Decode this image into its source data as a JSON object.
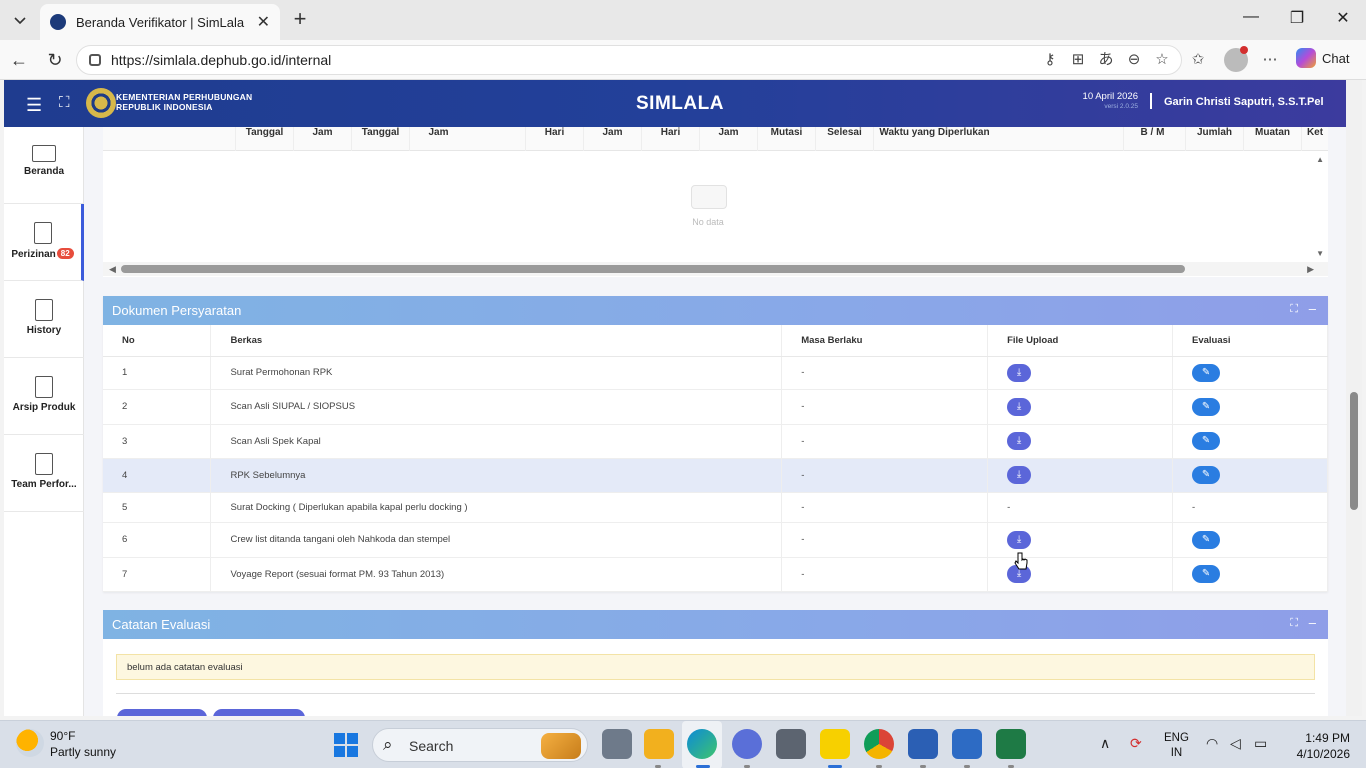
{
  "browser": {
    "tab_title": "Beranda Verifikator | SimLala",
    "url": "https://simlala.dephub.go.id/internal",
    "chat_label": "Chat"
  },
  "header": {
    "ministry_line1": "KEMENTERIAN PERHUBUNGAN",
    "ministry_line2": "REPUBLIK INDONESIA",
    "brand": "SIMLALA",
    "date": "10 April 2026",
    "version": "versi 2.0.25",
    "user": "Garin Christi Saputri, S.S.T.Pel"
  },
  "sidebar": {
    "items": [
      {
        "label": "Beranda",
        "icon": "monitor-icon"
      },
      {
        "label": "Perizinan",
        "icon": "document-icon",
        "badge": "82"
      },
      {
        "label": "History",
        "icon": "document-icon"
      },
      {
        "label": "Arsip Produk",
        "icon": "document-icon"
      },
      {
        "label": "Team Perfor...",
        "icon": "document-icon"
      }
    ]
  },
  "top_table": {
    "columns": [
      "Tanggal",
      "Jam",
      "Tanggal",
      "Jam",
      "Hari",
      "Jam",
      "Hari",
      "Jam",
      "Mutasi",
      "Selesai",
      "Waktu yang Diperlukan",
      "B / M",
      "Jumlah",
      "Muatan",
      "Ket"
    ],
    "empty_text": "No data"
  },
  "dokumen": {
    "title": "Dokumen Persyaratan",
    "headers": {
      "no": "No",
      "berkas": "Berkas",
      "masa": "Masa Berlaku",
      "upload": "File Upload",
      "evaluasi": "Evaluasi"
    },
    "rows": [
      {
        "no": "1",
        "berkas": "Surat Permohonan RPK",
        "masa": "-",
        "has_file": true
      },
      {
        "no": "2",
        "berkas": "Scan Asli SIUPAL / SIOPSUS",
        "masa": "-",
        "has_file": true
      },
      {
        "no": "3",
        "berkas": "Scan Asli Spek Kapal",
        "masa": "-",
        "has_file": true
      },
      {
        "no": "4",
        "berkas": "RPK Sebelumnya",
        "masa": "-",
        "has_file": true
      },
      {
        "no": "5",
        "berkas": "Surat Docking ( Diperlukan apabila kapal perlu docking )",
        "masa": "-",
        "has_file": false,
        "upload_text": "-",
        "eval_text": "-"
      },
      {
        "no": "6",
        "berkas": "Crew list ditanda tangani oleh Nahkoda dan stempel",
        "masa": "-",
        "has_file": true
      },
      {
        "no": "7",
        "berkas": "Voyage Report (sesuai format PM. 93 Tahun 2013)",
        "masa": "-",
        "has_file": true
      }
    ]
  },
  "catatan": {
    "title": "Catatan Evaluasi",
    "note": "belum ada catatan evaluasi"
  },
  "taskbar": {
    "temp": "90°F",
    "weather": "Partly sunny",
    "search_label": "Search",
    "lang1": "ENG",
    "lang2": "IN",
    "time": "1:49 PM",
    "date": "4/10/2026"
  },
  "colors": {
    "header": "#1f3c8f",
    "card_head": "#89a8e8",
    "download_btn": "#5b66d9",
    "eval_btn": "#2a7de1",
    "badge": "#e74c3c"
  }
}
